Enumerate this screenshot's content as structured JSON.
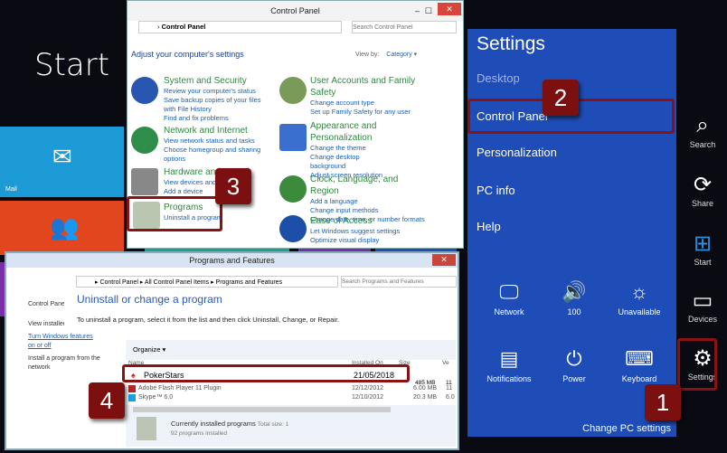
{
  "start": {
    "title": "Start",
    "tiles": {
      "mail": "Mail"
    }
  },
  "control_panel": {
    "title": "Control Panel",
    "breadcrumb": "Control Panel",
    "search_placeholder": "Search Control Panel",
    "heading": "Adjust your computer's settings",
    "view_by_label": "View by:",
    "view_by_value": "Category",
    "categories": [
      {
        "title": "System and Security",
        "links": [
          "Review your computer's status",
          "Save backup copies of your files with File History",
          "Find and fix problems"
        ]
      },
      {
        "title": "Network and Internet",
        "links": [
          "View network status and tasks",
          "Choose homegroup and sharing options"
        ]
      },
      {
        "title": "Hardware and Sound",
        "links": [
          "View devices and printers",
          "Add a device"
        ]
      },
      {
        "title": "Programs",
        "links": [
          "Uninstall a program"
        ]
      },
      {
        "title": "User Accounts and Family Safety",
        "links": [
          "Change account type",
          "Set up Family Safety for any user"
        ]
      },
      {
        "title": "Appearance and Personalization",
        "links": [
          "Change the theme",
          "Change desktop background",
          "Adjust screen resolution"
        ]
      },
      {
        "title": "Clock, Language, and Region",
        "links": [
          "Add a language",
          "Change input methods",
          "Change date, time, or number formats"
        ]
      },
      {
        "title": "Ease of Access",
        "links": [
          "Let Windows suggest settings",
          "Optimize visual display"
        ]
      }
    ]
  },
  "programs": {
    "title": "Programs and Features",
    "breadcrumb": [
      "Control Panel",
      "All Control Panel Items",
      "Programs and Features"
    ],
    "search_placeholder": "Search Programs and Features",
    "sidebar": [
      "Control Panel Home",
      "View installed updates",
      "Turn Windows features on or off",
      "Install a program from the network"
    ],
    "heading": "Uninstall or change a program",
    "instructions": "To uninstall a program, select it from the list and then click Uninstall, Change, or Repair.",
    "organize": "Organize",
    "columns": [
      "Name",
      "Installed On",
      "Size",
      "Ve"
    ],
    "rows": [
      {
        "name": "PokerStars",
        "installed": "21/05/2018",
        "size": "485 MB",
        "version": "11"
      },
      {
        "name": "Adobe Flash Player 11 Plugin",
        "installed": "12/12/2012",
        "size": "6.00 MB",
        "version": "11"
      },
      {
        "name": "Skype™ 6.0",
        "installed": "12/10/2012",
        "size": "20.3 MB",
        "version": "6.0"
      }
    ],
    "footer_title": "Currently installed programs",
    "footer_total": "Total size: 1",
    "footer_count": "92 programs installed"
  },
  "settings": {
    "title": "Settings",
    "items": [
      "Desktop",
      "Control Panel",
      "Personalization",
      "PC info",
      "Help"
    ],
    "quick": [
      {
        "icon": "network-icon",
        "label": "Network"
      },
      {
        "icon": "volume-icon",
        "label": "100"
      },
      {
        "icon": "brightness-icon",
        "label": "Unavailable"
      },
      {
        "icon": "notifications-icon",
        "label": "Notifications"
      },
      {
        "icon": "power-icon",
        "label": "Power"
      },
      {
        "icon": "keyboard-icon",
        "label": "Keyboard"
      }
    ],
    "change_pc": "Change PC settings"
  },
  "charms": [
    "Search",
    "Share",
    "Start",
    "Devices",
    "Settings"
  ],
  "callouts": [
    "1",
    "2",
    "3",
    "4"
  ],
  "colors": {
    "settings_bg": "#1f4db7",
    "callout": "#7c0f0f",
    "category": "#2b8a3e",
    "link": "#1a5fb4"
  }
}
